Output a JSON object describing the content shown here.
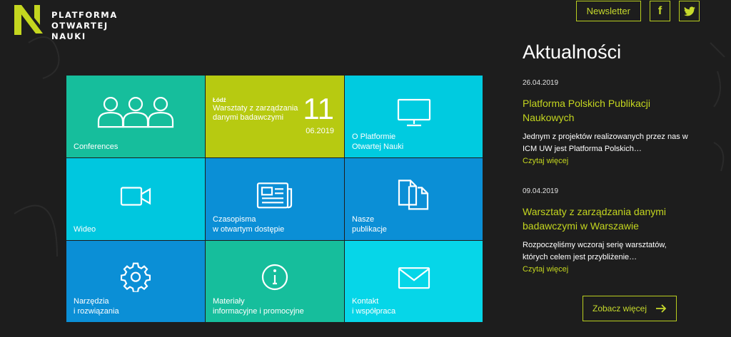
{
  "header": {
    "logo_lines": [
      "PLATFORMA",
      "OTWARTEJ",
      "NAUKI"
    ],
    "newsletter_label": "Newsletter",
    "facebook_glyph": "f",
    "twitter_icon": "twitter-icon"
  },
  "tiles": {
    "conferences": {
      "label": "Conferences",
      "icon": "people-icon"
    },
    "event": {
      "city": "Łódź",
      "title": "Warsztaty z zarządzania\ndanymi badawczymi",
      "day": "11",
      "month_year": "06.2019"
    },
    "about": {
      "label": "O Platformie\nOtwartej Nauki",
      "icon": "monitor-icon"
    },
    "video": {
      "label": "Wideo",
      "icon": "video-camera-icon"
    },
    "journals": {
      "label": "Czasopisma\nw otwartym dostępie",
      "icon": "newspaper-icon"
    },
    "publications": {
      "label": "Nasze\npublikacje",
      "icon": "documents-icon"
    },
    "tools": {
      "label": "Narzędzia\ni rozwiązania",
      "icon": "gear-icon"
    },
    "materials": {
      "label": "Materiały\ninformacyjne i promocyjne",
      "icon": "info-icon"
    },
    "contact": {
      "label": "Kontakt\ni współpraca",
      "icon": "envelope-icon"
    }
  },
  "news": {
    "heading": "Aktualności",
    "items": [
      {
        "date": "26.04.2019",
        "title": "Platforma Polskich Publikacji Naukowych",
        "excerpt": "Jednym z projektów realizowanych przez nas w ICM UW jest Platforma Polskich…",
        "more": "Czytaj więcej"
      },
      {
        "date": "09.04.2019",
        "title": "Warsztaty z zarządzania danymi badawczymi w Warszawie",
        "excerpt": "Rozpoczęliśmy wczoraj serię warsztatów, których celem jest przybliżenie…",
        "more": "Czytaj więcej"
      }
    ],
    "see_more_label": "Zobacz więcej"
  },
  "colors": {
    "background": "#1d1d1d",
    "accent": "#c4d61f",
    "tile_green": "#16be9c",
    "tile_lime": "#b7ca11",
    "tile_cyan": "#00cbe0",
    "tile_blue": "#0b8fd6"
  }
}
